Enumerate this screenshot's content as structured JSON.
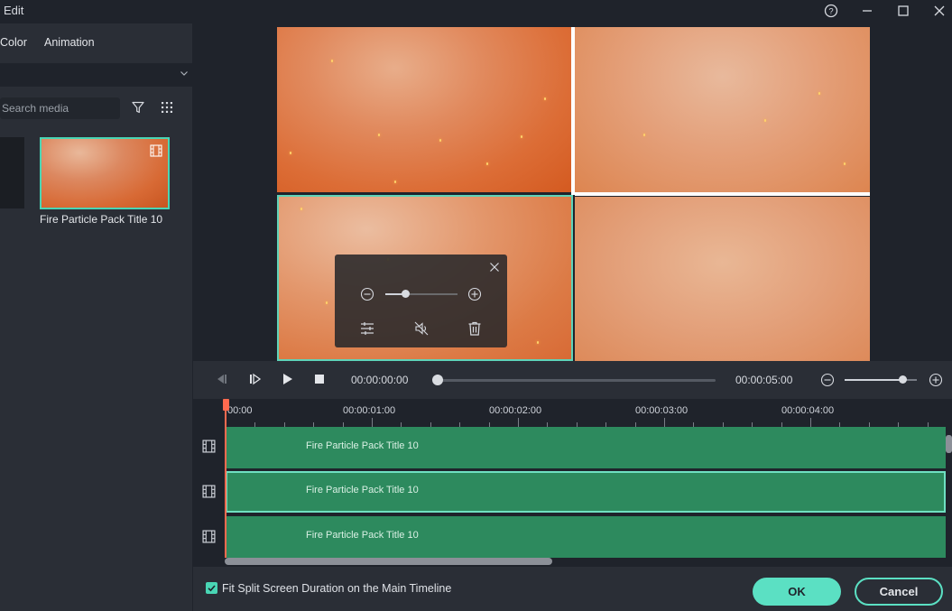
{
  "window": {
    "title": "Edit"
  },
  "left_panel": {
    "tabs": [
      "Color",
      "Animation"
    ],
    "search": {
      "placeholder": "Search media",
      "value": ""
    },
    "media_items": [
      {
        "label": "Fire Particle Pack Title 10"
      }
    ]
  },
  "transport": {
    "current_time": "00:00:00:00",
    "total_time": "00:00:05:00",
    "scrub_progress": 0.0,
    "zoom_level": 0.8
  },
  "preview_popup": {
    "zoom_level": 0.28
  },
  "timeline": {
    "ruler_labels": [
      "00:00",
      "00:00:01:00",
      "00:00:02:00",
      "00:00:03:00",
      "00:00:04:00"
    ],
    "tracks": [
      {
        "clip_label": "Fire Particle Pack Title 10",
        "selected": false
      },
      {
        "clip_label": "Fire Particle Pack Title 10",
        "selected": true
      },
      {
        "clip_label": "Fire Particle Pack Title 10",
        "selected": false
      }
    ]
  },
  "footer": {
    "fit_duration_label": "Fit Split Screen Duration on the Main Timeline",
    "fit_duration_checked": true,
    "ok_label": "OK",
    "cancel_label": "Cancel"
  },
  "colors": {
    "accent": "#5be0c3",
    "clip": "#2d8a5e",
    "playhead": "#ff6a4f"
  },
  "icons": [
    "help-icon",
    "minimize-icon",
    "maximize-icon",
    "close-icon",
    "chevron-down-icon",
    "filter-icon",
    "grid-icon",
    "film-icon",
    "zoom-out-icon",
    "zoom-in-icon",
    "adjust-icon",
    "mute-icon",
    "trash-icon",
    "prev-frame-icon",
    "play-frame-icon",
    "play-icon",
    "stop-icon"
  ]
}
